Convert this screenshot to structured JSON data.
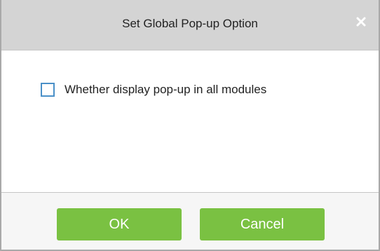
{
  "dialog": {
    "title": "Set Global Pop-up Option",
    "close_icon": "close-icon",
    "option": {
      "label": "Whether display pop-up in all modules",
      "checked": false
    },
    "buttons": {
      "ok_label": "OK",
      "cancel_label": "Cancel"
    },
    "colors": {
      "button_green": "#7ac142",
      "checkbox_border": "#4a90c8",
      "titlebar_bg": "#d4d4d4"
    }
  }
}
